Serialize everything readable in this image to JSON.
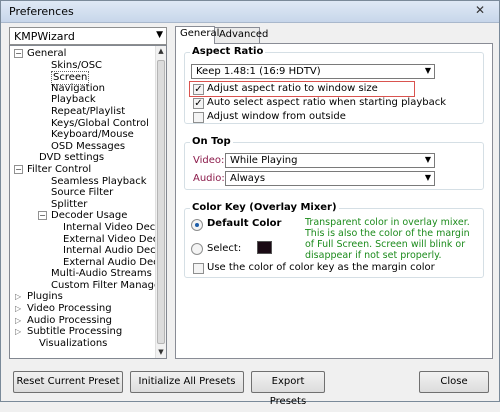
{
  "window": {
    "title": "Preferences"
  },
  "preset": {
    "selected": "KMPWizard"
  },
  "tree": {
    "items": [
      {
        "label": "General",
        "indent": 0,
        "expander": "-"
      },
      {
        "label": "Skins/OSC",
        "indent": 2
      },
      {
        "label": "Screen",
        "indent": 2,
        "selected": true
      },
      {
        "label": "Navigation",
        "indent": 2
      },
      {
        "label": "Playback",
        "indent": 2
      },
      {
        "label": "Repeat/Playlist",
        "indent": 2
      },
      {
        "label": "Keys/Global Control",
        "indent": 2
      },
      {
        "label": "Keyboard/Mouse",
        "indent": 2
      },
      {
        "label": "OSD Messages",
        "indent": 2
      },
      {
        "label": "DVD settings",
        "indent": 1
      },
      {
        "label": "Filter Control",
        "indent": 0,
        "expander": "-"
      },
      {
        "label": "Seamless Playback",
        "indent": 2
      },
      {
        "label": "Source Filter",
        "indent": 2
      },
      {
        "label": "Splitter",
        "indent": 2
      },
      {
        "label": "Decoder Usage",
        "indent": 2,
        "expander": "-"
      },
      {
        "label": "Internal Video Decoder",
        "indent": 3
      },
      {
        "label": "External Video Decoder",
        "indent": 3
      },
      {
        "label": "Internal Audio Decoder",
        "indent": 3
      },
      {
        "label": "External Audio Decoder",
        "indent": 3
      },
      {
        "label": "Multi-Audio Streams",
        "indent": 2
      },
      {
        "label": "Custom Filter Manager",
        "indent": 2
      },
      {
        "label": "Plugins",
        "indent": 0,
        "expander": ">"
      },
      {
        "label": "Video Processing",
        "indent": 0,
        "expander": ">"
      },
      {
        "label": "Audio Processing",
        "indent": 0,
        "expander": ">"
      },
      {
        "label": "Subtitle Processing",
        "indent": 0,
        "expander": ">"
      },
      {
        "label": "Visualizations",
        "indent": 1
      }
    ]
  },
  "tabs": {
    "general": "General",
    "advanced": "Advanced"
  },
  "aspect": {
    "title": "Aspect Ratio",
    "dropdown_value": "Keep 1.48:1 (16:9 HDTV)",
    "opt1": "Adjust aspect ratio to window size",
    "opt2": "Auto select aspect ratio when starting playback",
    "opt3": "Adjust window from outside"
  },
  "ontop": {
    "title": "On Top",
    "video_label": "Video:",
    "video_value": "While Playing",
    "audio_label": "Audio:",
    "audio_value": "Always"
  },
  "colorkey": {
    "title": "Color Key (Overlay Mixer)",
    "default_label": "Default Color",
    "select_label": "Select:",
    "margin_label": "Use the color of color key as the margin color",
    "note": "Transparent color in overlay mixer. This is also the color of the margin of Full Screen. Screen will blink or disappear if not set properly.",
    "swatch_color": "#1a0a14"
  },
  "buttons": {
    "reset": "Reset Current Preset",
    "init": "Initialize All Presets",
    "export": "Export Presets",
    "close": "Close"
  }
}
